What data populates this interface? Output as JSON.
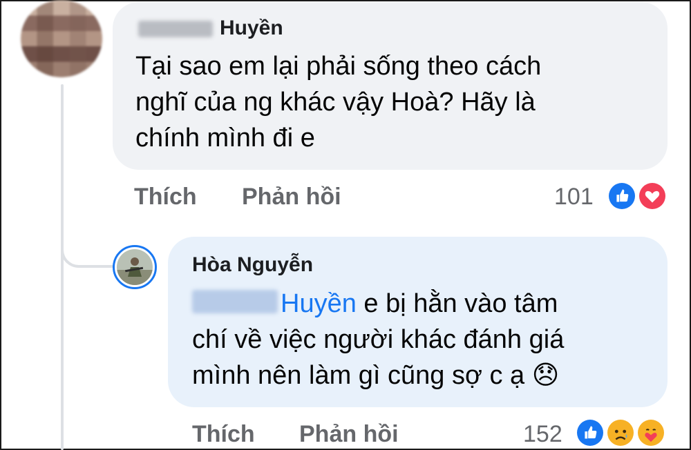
{
  "comment": {
    "author_suffix": "Huyền",
    "text_lines": [
      "Tại sao em lại phải sống theo cách",
      "nghĩ của ng khác vậy Hoà? Hãy là",
      "chính mình đi e"
    ],
    "actions": {
      "like": "Thích",
      "reply": "Phản hồi"
    },
    "reaction_count": "101",
    "reaction_icons": [
      "like-icon",
      "love-icon"
    ]
  },
  "reply": {
    "author": "Hòa Nguyễn",
    "mention": "Huyền",
    "line1_rest": " e bị hằn vào tâm",
    "line2": "chí về việc người khác đánh giá",
    "line3": "mình nên làm gì cũng sợ c ạ ",
    "emoji": "😞",
    "actions": {
      "like": "Thích",
      "reply": "Phản hồi"
    },
    "reaction_count": "152",
    "reaction_icons": [
      "like-icon",
      "sad-icon",
      "care-icon"
    ]
  },
  "colors": {
    "accent": "#1877f2",
    "bubble": "#f0f2f5",
    "reply_bubble": "#e8f1fb",
    "muted": "#65676b",
    "love": "#f33e58",
    "haha": "#f7b125"
  }
}
